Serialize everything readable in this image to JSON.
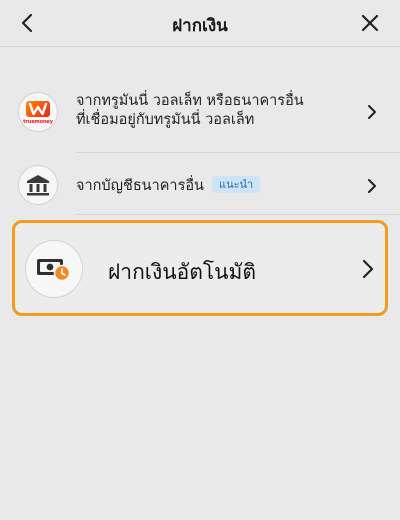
{
  "header": {
    "title": "ฝากเงิน"
  },
  "options": [
    {
      "icon": "truemoney-logo",
      "logo_text": "truemoney",
      "line1": "จากทรูมันนี่ วอลเล็ท หรือธนาคารอื่น",
      "line2": "ที่เชื่อมอยู่กับทรูมันนี่ วอลเล็ท"
    },
    {
      "icon": "bank-icon",
      "label": "จากบัญชีธนาคารอื่น",
      "badge": "แนะนำ"
    },
    {
      "icon": "money-clock-icon",
      "label": "ฝากเงินอัตโนมัติ",
      "highlighted": true
    }
  ],
  "colors": {
    "highlight_border": "#f59a1f",
    "badge_bg": "#cde3f6",
    "badge_text": "#2a6fb5",
    "accent_icon": "#f08a24"
  }
}
